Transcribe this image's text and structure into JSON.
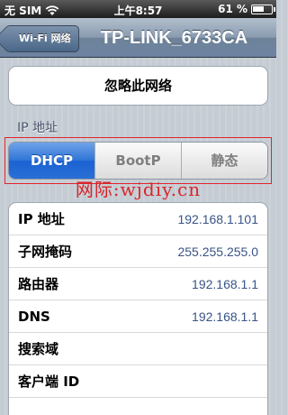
{
  "status_bar": {
    "carrier": "无 SIM",
    "time": "上午8:57",
    "battery": "61 %",
    "battery_level": 0.61
  },
  "nav": {
    "back_label": "Wi-Fi 网络",
    "title": "TP-LINK_6733CA"
  },
  "forget_label": "忽略此网络",
  "ip_section_header": "IP 地址",
  "segments": [
    "DHCP",
    "BootP",
    "静态"
  ],
  "selected_segment": "DHCP",
  "watermark": "网际:wjdiy.cn",
  "rows": [
    {
      "label": "IP 地址",
      "value": "192.168.1.101"
    },
    {
      "label": "子网掩码",
      "value": "255.255.255.0"
    },
    {
      "label": "路由器",
      "value": "192.168.1.1"
    },
    {
      "label": "DNS",
      "value": "192.168.1.1"
    },
    {
      "label": "搜索域",
      "value": ""
    },
    {
      "label": "客户端 ID",
      "value": ""
    }
  ]
}
